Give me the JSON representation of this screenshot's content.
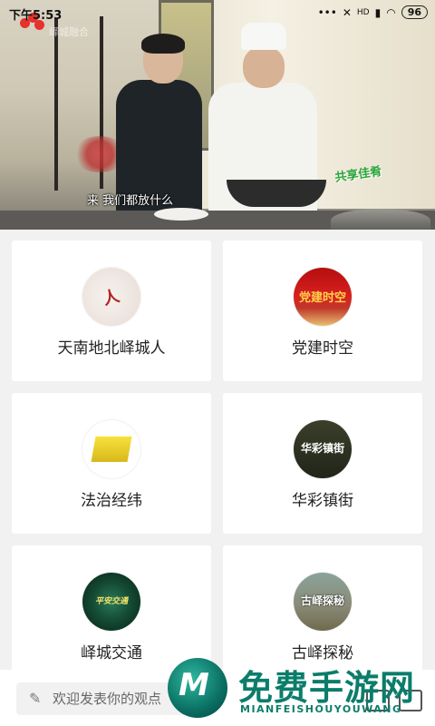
{
  "status_bar": {
    "time": "下午5:53",
    "battery": "96",
    "network": "HD"
  },
  "video": {
    "subtitle": "来 我们都放什么",
    "badge": "共享佳肴",
    "watermark": "峄城融合"
  },
  "channels": [
    {
      "label": "天南地北峄城人",
      "thumb_text": "人"
    },
    {
      "label": "党建时空",
      "thumb_text": "党建时空"
    },
    {
      "label": "法治经纬",
      "thumb_text": ""
    },
    {
      "label": "华彩镇街",
      "thumb_text": "华彩镇街"
    },
    {
      "label": "峄城交通",
      "thumb_text": "平安交通"
    },
    {
      "label": "古峄探秘",
      "thumb_text": "古峄探秘"
    }
  ],
  "bottom_bar": {
    "comment_placeholder": "欢迎发表你的观点"
  },
  "watermark": {
    "title": "免费手游网",
    "subtitle": "MIANFEISHOUYOUWANG",
    "logo_letter": "M"
  }
}
